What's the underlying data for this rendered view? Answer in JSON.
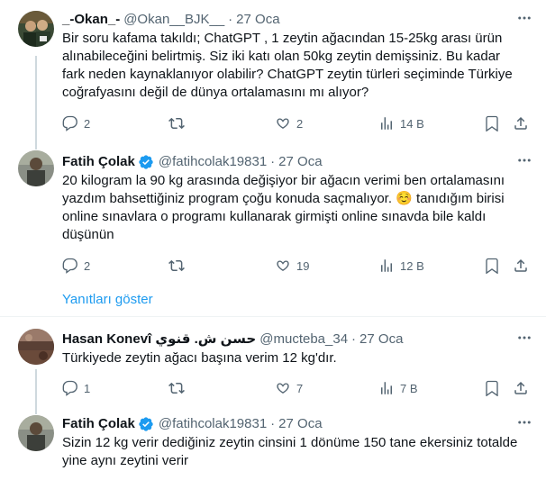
{
  "colors": {
    "accent": "#1d9bf0",
    "text": "#0f1419",
    "muted": "#536471",
    "divider": "#eff3f4"
  },
  "tweets": [
    {
      "name": "_-Okan_-",
      "handle": "@Okan__BJK__",
      "dot": "·",
      "date": "27 Oca",
      "verified": false,
      "avatar_icon": "avatar-photo",
      "lines": [
        "Bir soru kafama takıldı; ChatGPT , 1 zeytin ağacından 15-25kg arası ürün",
        "alınabileceğini belirtmiş. Siz iki katı olan 50kg zeytin demişsiniz. Bu kadar",
        "fark neden kaynaklanıyor olabilir? ChatGPT zeytin türleri seçiminde Türkiye",
        "coğrafyasını değil de dünya ortalamasını mı alıyor?"
      ],
      "replies": "2",
      "retweets": "",
      "likes": "2",
      "views": "14 B"
    },
    {
      "name": "Fatih Çolak",
      "handle": "@fatihcolak19831",
      "dot": "·",
      "date": "27 Oca",
      "verified": true,
      "avatar_icon": "avatar-photo",
      "lines": [
        "20 kilogram la 90 kg arasında değişiyor bir ağacın verimi ben ortalamasını",
        "yazdım bahsettiğiniz program çoğu konuda saçmalıyor. ☺️ tanıdığım birisi",
        "online sınavlara o programı kullanarak girmişti online sınavda bile kaldı",
        "düşünün"
      ],
      "replies": "2",
      "retweets": "",
      "likes": "19",
      "views": "12 B"
    },
    {
      "name": "Hasan Konevî حسن ش. قنوي",
      "handle": "@mucteba_34",
      "dot": "·",
      "date": "27 Oca",
      "verified": false,
      "avatar_icon": "avatar-photo",
      "lines": [
        "Türkiyede zeytin ağacı başına verim 12 kg'dır."
      ],
      "replies": "1",
      "retweets": "",
      "likes": "7",
      "views": "7 B"
    },
    {
      "name": "Fatih Çolak",
      "handle": "@fatihcolak19831",
      "dot": "·",
      "date": "27 Oca",
      "verified": true,
      "avatar_icon": "avatar-photo",
      "lines": [
        "Sizin 12 kg verir dediğiniz zeytin cinsini 1 dönüme 150 tane ekersiniz totalde",
        "yine aynı zeytini verir"
      ]
    }
  ],
  "show_replies": "Yanıtları göster"
}
